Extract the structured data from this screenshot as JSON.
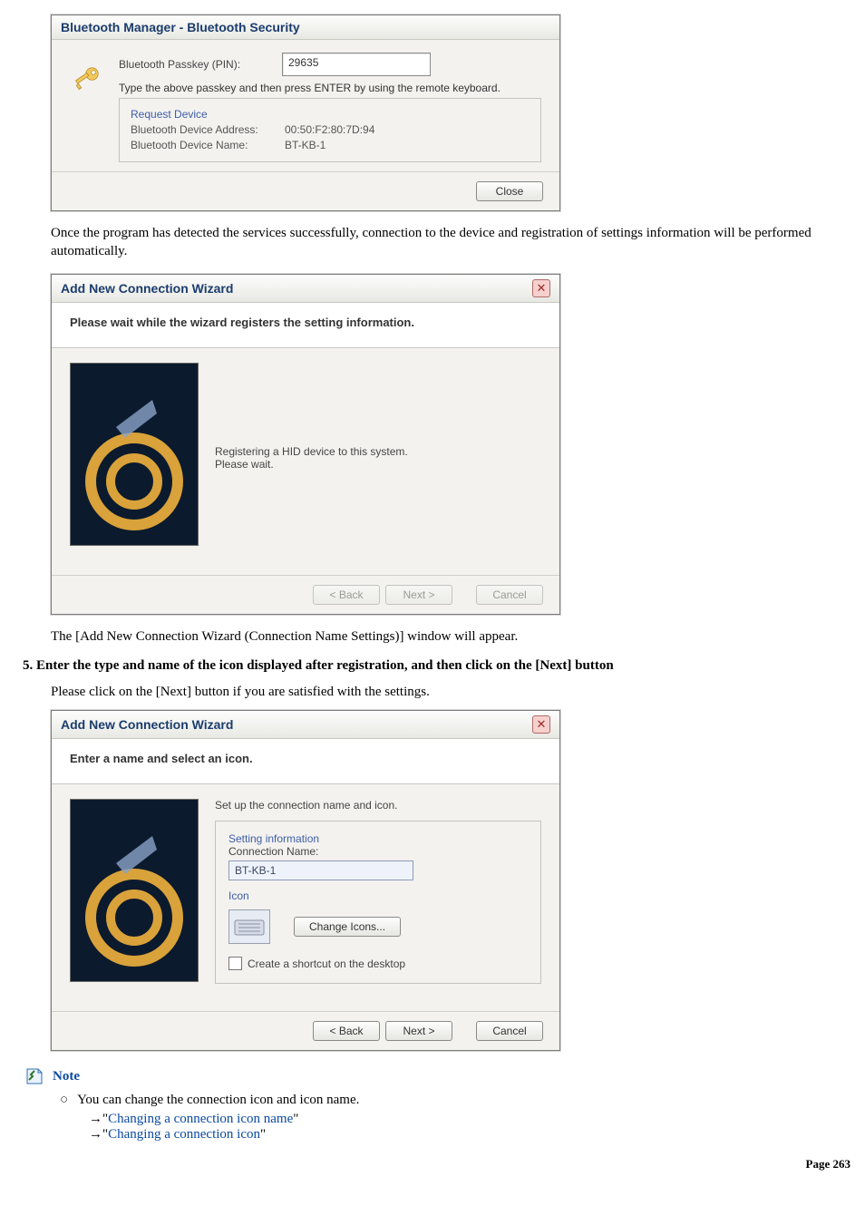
{
  "dialog_bt": {
    "title": "Bluetooth Manager - Bluetooth Security",
    "passkey_label": "Bluetooth Passkey (PIN):",
    "passkey_value": "29635",
    "instruction": "Type the above passkey and then press ENTER by using the remote keyboard.",
    "group_title": "Request Device",
    "addr_label": "Bluetooth Device Address:",
    "addr_value": "00:50:F2:80:7D:94",
    "name_label": "Bluetooth Device Name:",
    "name_value": "BT-KB-1",
    "close": "Close"
  },
  "para1": "Once the program has detected the services successfully, connection to the device and registration of settings information will be performed automatically.",
  "wizard1": {
    "title": "Add New Connection Wizard",
    "heading": "Please wait while the wizard registers the setting information.",
    "msg1": "Registering a HID device to this system.",
    "msg2": "Please wait.",
    "back": "< Back",
    "next": "Next >",
    "cancel": "Cancel"
  },
  "para2": "The [Add New Connection Wizard (Connection Name Settings)] window will appear.",
  "step5": "Enter the type and name of the icon displayed after registration, and then click on the [Next] button",
  "para3": "Please click on the [Next] button if you are satisfied with the settings.",
  "wizard2": {
    "title": "Add New Connection Wizard",
    "heading": "Enter a name and select an icon.",
    "setup_label": "Set up the connection name and icon.",
    "group_title": "Setting information",
    "conn_name_label": "Connection Name:",
    "conn_name_value": "BT-KB-1",
    "icon_label": "Icon",
    "change_icons": "Change Icons...",
    "shortcut": "Create a shortcut on the desktop",
    "back": "< Back",
    "next": "Next >",
    "cancel": "Cancel"
  },
  "note": {
    "label": "Note",
    "line1": "You can change the connection icon and icon name.",
    "link1": "Changing a connection icon name",
    "link2": "Changing a connection icon"
  },
  "page_number": "Page 263"
}
